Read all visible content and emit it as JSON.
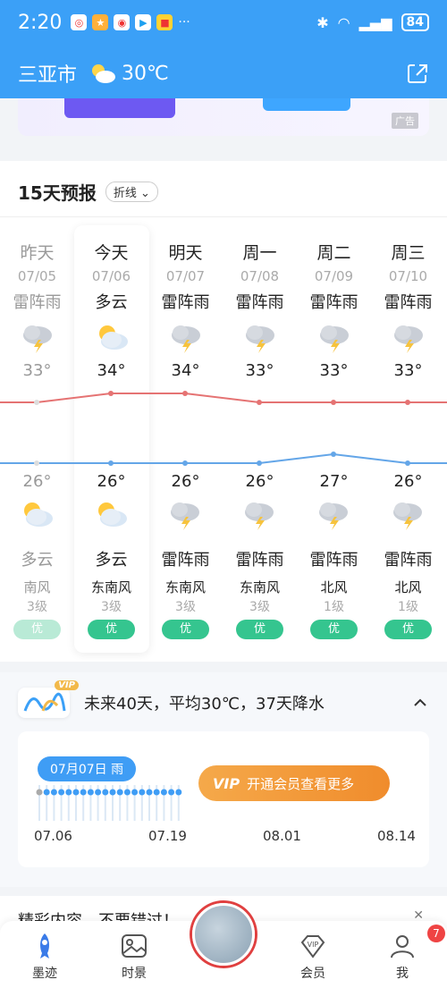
{
  "status_bar": {
    "time": "2:20",
    "battery": "84"
  },
  "header": {
    "city": "三亚市",
    "temperature": "30℃"
  },
  "ad": {
    "tag": "广告"
  },
  "forecast": {
    "title": "15天预报",
    "view_toggle": "折线",
    "days": [
      {
        "name": "昨天",
        "date": "07/05",
        "day_cond": "雷阵雨",
        "high": "33°",
        "low": "26°",
        "night_cond": "多云",
        "wind_dir": "南风",
        "wind_level": "3级",
        "aqi": "优",
        "past": true,
        "day_icon": "thunderstorm-icon",
        "night_icon": "partly-cloudy-icon"
      },
      {
        "name": "今天",
        "date": "07/06",
        "day_cond": "多云",
        "high": "34°",
        "low": "26°",
        "night_cond": "多云",
        "wind_dir": "东南风",
        "wind_level": "3级",
        "aqi": "优",
        "past": false,
        "day_icon": "partly-cloudy-icon",
        "night_icon": "partly-cloudy-icon"
      },
      {
        "name": "明天",
        "date": "07/07",
        "day_cond": "雷阵雨",
        "high": "34°",
        "low": "26°",
        "night_cond": "雷阵雨",
        "wind_dir": "东南风",
        "wind_level": "3级",
        "aqi": "优",
        "past": false,
        "day_icon": "thunderstorm-icon",
        "night_icon": "thunderstorm-icon"
      },
      {
        "name": "周一",
        "date": "07/08",
        "day_cond": "雷阵雨",
        "high": "33°",
        "low": "26°",
        "night_cond": "雷阵雨",
        "wind_dir": "东南风",
        "wind_level": "3级",
        "aqi": "优",
        "past": false,
        "day_icon": "thunderstorm-icon",
        "night_icon": "thunderstorm-icon"
      },
      {
        "name": "周二",
        "date": "07/09",
        "day_cond": "雷阵雨",
        "high": "33°",
        "low": "27°",
        "night_cond": "雷阵雨",
        "wind_dir": "北风",
        "wind_level": "1级",
        "aqi": "优",
        "past": false,
        "day_icon": "thunderstorm-icon",
        "night_icon": "thunderstorm-icon"
      },
      {
        "name": "周三",
        "date": "07/10",
        "day_cond": "雷阵雨",
        "high": "33°",
        "low": "26°",
        "night_cond": "雷阵雨",
        "wind_dir": "北风",
        "wind_level": "1级",
        "aqi": "优",
        "past": false,
        "day_icon": "thunderstorm-icon",
        "night_icon": "thunderstorm-icon"
      }
    ],
    "colors": {
      "high_line": "#e57373",
      "low_line": "#64a6e8",
      "aqi_good": "#35c58f"
    }
  },
  "long_range": {
    "vip_badge": "VIP",
    "summary": "未来40天，平均30℃，37天降水",
    "selected_date": "07月07日 雨",
    "cta_mark": "VIP",
    "cta_label": "开通会员查看更多",
    "ticks": [
      "07.06",
      "07.19",
      "08.01",
      "08.14"
    ]
  },
  "promo": {
    "text": "精彩内容，不要错过！",
    "close": "✕"
  },
  "bottom_nav": {
    "items": [
      {
        "label": "墨迹",
        "icon": "rocket-icon"
      },
      {
        "label": "时景",
        "icon": "photo-icon"
      },
      {
        "label": "会员",
        "icon": "vip-diamond-icon"
      },
      {
        "label": "我",
        "icon": "user-icon",
        "badge": "7"
      }
    ]
  }
}
